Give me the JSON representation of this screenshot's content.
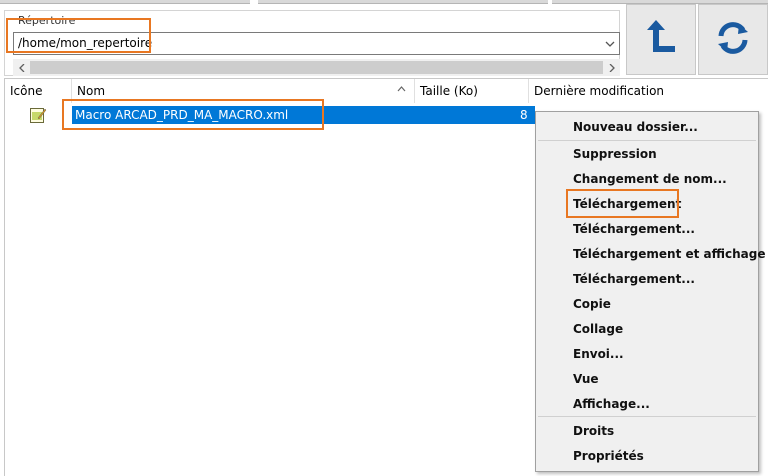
{
  "directory": {
    "label": "Répertoire",
    "path": "/home/mon_repertoire"
  },
  "toolbar": {
    "up_icon": "arrow-up-corner-icon",
    "refresh_icon": "refresh-icon",
    "accent_color": "#1a5aa0"
  },
  "columns": {
    "icon": "Icône",
    "name": "Nom",
    "size": "Taille (Ko)",
    "modified": "Dernière modification"
  },
  "files": [
    {
      "icon": "xml-file-icon",
      "name": "Macro ARCAD_PRD_MA_MACRO.xml",
      "size": "8"
    }
  ],
  "context_menu": {
    "items": [
      "Nouveau dossier...",
      "Suppression",
      "Changement de nom...",
      "Téléchargement",
      "Téléchargement...",
      "Téléchargement et affichage",
      "Téléchargement...",
      "Copie",
      "Collage",
      "Envoi...",
      "Vue",
      "Affichage...",
      "Droits",
      "Propriétés"
    ]
  },
  "highlight_color": "#e87722",
  "selection_color": "#0078d7"
}
